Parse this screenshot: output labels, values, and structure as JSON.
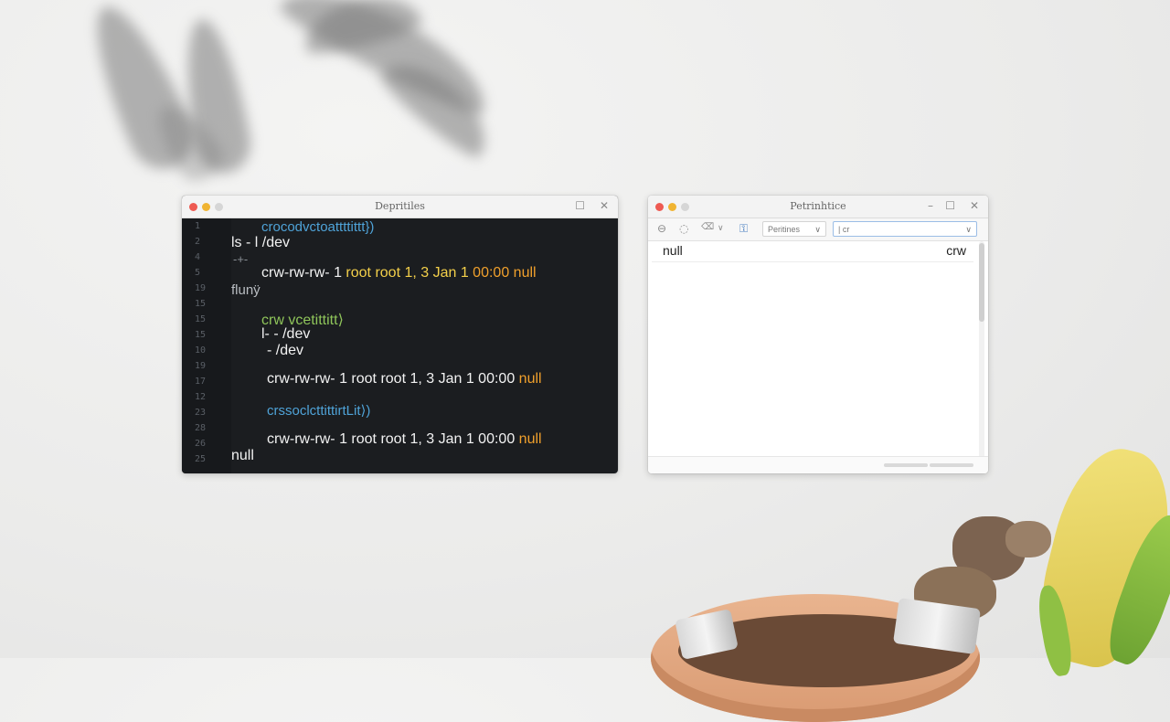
{
  "terminal": {
    "title": "Depritiles",
    "line_numbers": [
      "1",
      "2",
      "4",
      "5",
      "19",
      "15",
      "15",
      "15",
      "10",
      "19",
      "17",
      "12",
      "23",
      "28",
      "26",
      "25"
    ],
    "lines": [
      {
        "text": "crocodvctoattttittt})",
        "style": "blue"
      },
      {
        "text": "ls - l /dev",
        "style": "big"
      },
      {
        "text": "-+-",
        "style": "dim"
      },
      {
        "prefix": "crw-rw-rw- 1 ",
        "mid": "root root 1, 3 Jan 1 ",
        "time": "00:00",
        "tail": " null"
      },
      {
        "text": "flunÿ",
        "style": "dim"
      },
      {
        "text": "crw vcetittitt⟩",
        "style": "green"
      },
      {
        "text": "l- - /dev",
        "style": "big"
      },
      {
        "text": "- /dev",
        "style": "big"
      },
      {
        "text": "crw-rw-rw-  1 root root 1, 3 Jan 1 00:00",
        "tail": " null"
      },
      {
        "text": "crssoclcttittirtLit⟩)",
        "style": "blue"
      },
      {
        "text": "crw-rw-rw-  1 root root 1, 3 Jan 1 00:00",
        "tail": " null"
      },
      {
        "text": "null",
        "style": "big"
      }
    ]
  },
  "editor": {
    "title": "Petrinhtice",
    "toolbar": {
      "dropdown1_label": "Peritines",
      "dropdown2_value": "| cr"
    },
    "rows": [
      {
        "name": "null",
        "type": "crw"
      }
    ]
  },
  "colors": {
    "accent_yellow": "#f4d04a",
    "accent_orange": "#f0a02c",
    "terminal_bg": "#1b1d20"
  }
}
